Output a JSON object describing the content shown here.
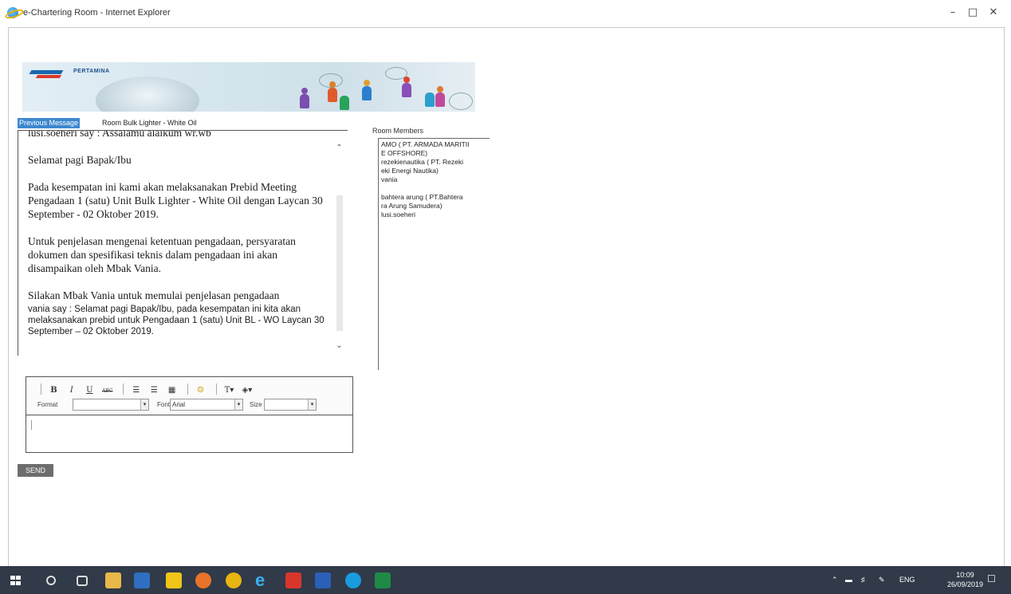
{
  "window": {
    "title": "e-Chartering Room - Internet Explorer",
    "minimize": "–",
    "restore": "□",
    "close": "✕"
  },
  "banner": {
    "brand": "PERTAMINA"
  },
  "tabs": {
    "previous_message": "Previous Message",
    "room_name": "Room Bulk Lighter - White Oil"
  },
  "chat": {
    "header_line": "lusi.soeheri say : Assalamu alaikum wr.wb",
    "greeting": "Selamat pagi Bapak/Ibu",
    "para1": "Pada kesempatan ini kami akan melaksanakan Prebid Meeting Pengadaan 1 (satu) Unit Bulk Lighter - White Oil dengan Laycan 30 September - 02 Oktober 2019.",
    "para2": "Untuk penjelasan mengenai ketentuan pengadaan, persyaratan dokumen dan spesifikasi teknis dalam pengadaan ini akan disampaikan oleh Mbak Vania.",
    "para3": "Silakan Mbak Vania untuk memulai penjelasan pengadaan",
    "vania_msg": "vania say : Selamat pagi Bapak/Ibu, pada kesempatan ini kita akan melaksanakan prebid untuk Pengadaan 1 (satu) Unit BL - WO Laycan 30 September – 02 Oktober 2019."
  },
  "members": {
    "label": "Room Members",
    "items": [
      "AMO ( PT. ARMADA MARITII",
      "E OFFSHORE)",
      "rezekienautika ( PT. Rezeki",
      "eki Energi Nautika)",
      "vania",
      "",
      "bahtera arung ( PT.Bahtera",
      "ra Arung Samudera)",
      "lusi.soeheri"
    ]
  },
  "editor": {
    "bold": "B",
    "italic": "I",
    "underline": "U",
    "strike": "ABC",
    "format_label": "Format",
    "format_value": "",
    "font_label": "Font",
    "font_value": "Arial",
    "size_label": "Size",
    "size_value": ""
  },
  "send_label": "SEND",
  "taskbar": {
    "lang": "ENG",
    "time": "10:09",
    "date": "26/09/2019"
  }
}
